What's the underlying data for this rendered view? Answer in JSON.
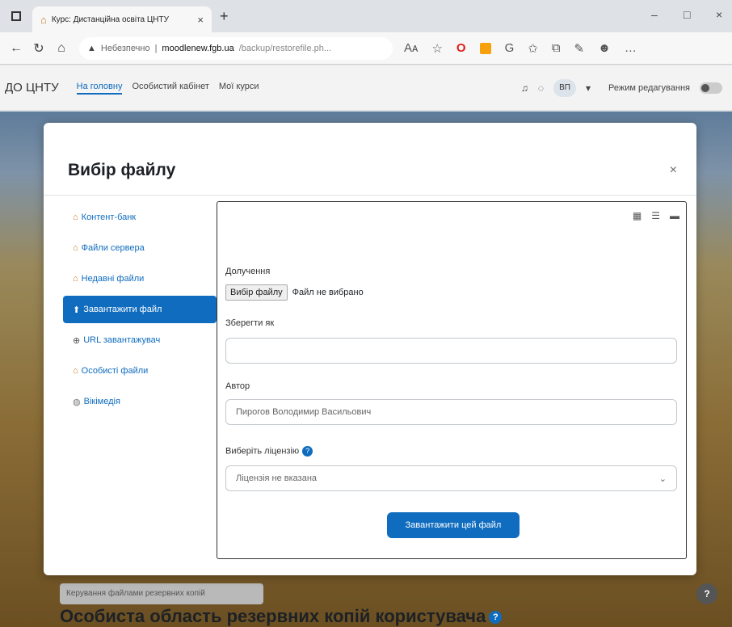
{
  "browser": {
    "tab_title": "Курс: Дистанційна освіта ЦНТУ",
    "new_tab": "+",
    "url_warning": "Небезпечно",
    "url_host": "moodlenew.fgb.ua",
    "url_path": "/backup/restorefile.ph...",
    "reader_mode": "Aᴀ"
  },
  "navbar": {
    "brand": "ДО ЦНТУ",
    "links": [
      "На головну",
      "Особистий кабінет",
      "Мої курси"
    ],
    "user_initials": "ВП",
    "edit_mode": "Режим редагування"
  },
  "modal": {
    "title": "Вибір файлу",
    "close": "×",
    "sidebar": [
      {
        "label": "Контент-банк",
        "icon": "repository-icon"
      },
      {
        "label": "Файли сервера",
        "icon": "repository-icon"
      },
      {
        "label": "Недавні файли",
        "icon": "repository-icon"
      },
      {
        "label": "Завантажити файл",
        "icon": "upload-icon",
        "active": true
      },
      {
        "label": "URL завантажувач",
        "icon": "url-icon"
      },
      {
        "label": "Особисті файли",
        "icon": "repository-icon"
      },
      {
        "label": "Вікімедія",
        "icon": "wikimedia-icon"
      }
    ],
    "form": {
      "attachment_label": "Долучення",
      "choose_button": "Вибір файлу",
      "no_file": "Файл не вибрано",
      "save_as_label": "Зберегти як",
      "save_as_value": "",
      "author_label": "Автор",
      "author_value": "Пирогов Володимир Васильович",
      "license_label": "Виберіть ліцензію",
      "license_value": "Ліцензія не вказана",
      "upload_button": "Завантажити цей файл"
    }
  },
  "page": {
    "manage_button": "Керування файлами резервних копій",
    "heading": "Особиста область резервних копій користувача"
  },
  "colors": {
    "accent": "#0f6cbf",
    "active_bg": "#0f6cbf"
  }
}
